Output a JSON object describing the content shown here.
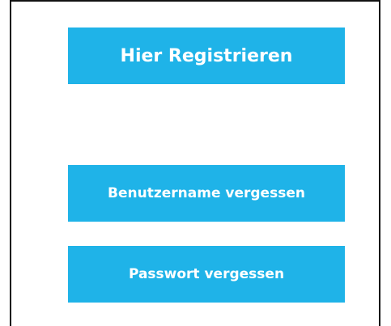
{
  "buttons": {
    "register_label": "Hier Registrieren",
    "forgot_username_label": "Benutzername vergessen",
    "forgot_password_label": "Passwort vergessen"
  },
  "colors": {
    "button_background": "#1fb3e8",
    "button_text": "#ffffff",
    "frame_border": "#111111"
  }
}
